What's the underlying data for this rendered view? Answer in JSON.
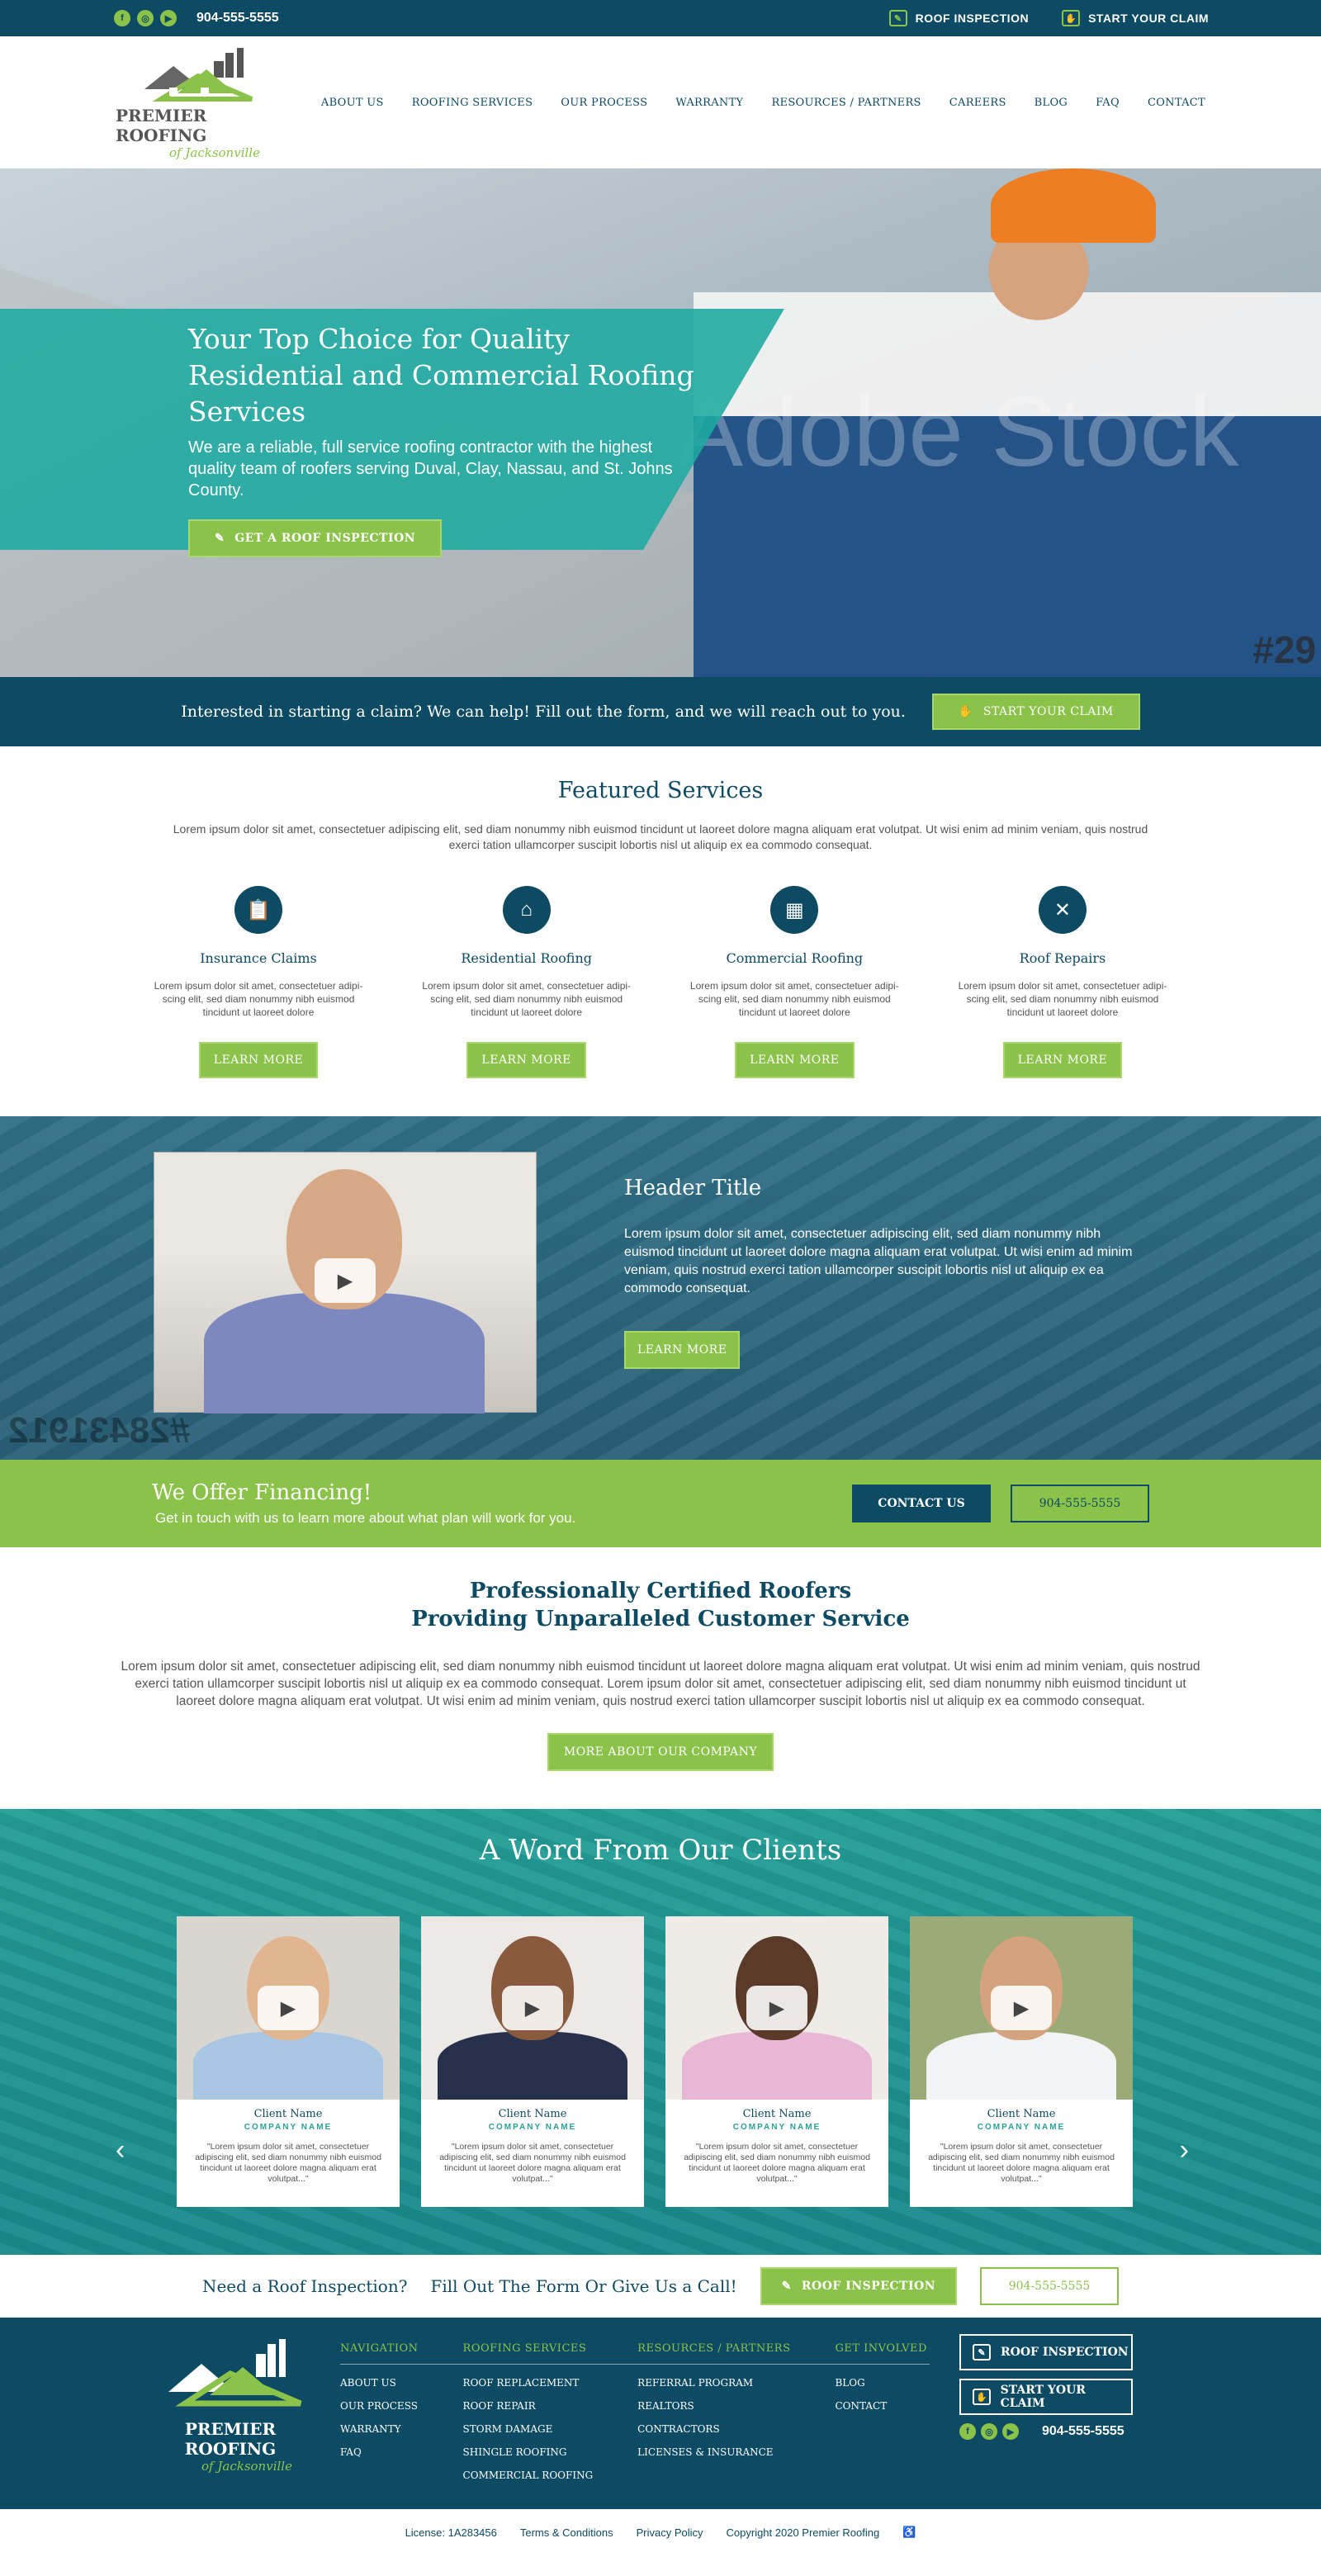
{
  "topbar": {
    "phone": "904-555-5555",
    "social": [
      "facebook-icon",
      "instagram-icon",
      "youtube-icon"
    ],
    "links": [
      {
        "label": "ROOF INSPECTION",
        "icon": "clipboard-icon"
      },
      {
        "label": "START YOUR CLAIM",
        "icon": "claim-icon"
      }
    ]
  },
  "logo": {
    "name": "PREMIER ROOFING",
    "tagline": "of Jacksonville"
  },
  "nav": [
    "ABOUT US",
    "ROOFING SERVICES",
    "OUR PROCESS",
    "WARRANTY",
    "RESOURCES / PARTNERS",
    "CAREERS",
    "BLOG",
    "FAQ",
    "CONTACT"
  ],
  "hero": {
    "title": "Your Top Choice for Quality Residential and Commercial Roofing Services",
    "subtitle": "We are a reliable, full service roofing contractor with the highest quality team of roofers serving Duval, Clay, Nassau, and St. Johns County.",
    "button": "GET A ROOF INSPECTION",
    "watermark": "Adobe Stock",
    "watermark_id": "#29"
  },
  "claim_bar": {
    "text": "Interested in starting a claim?   We can help!   Fill out the form, and we will reach out to you.",
    "button": "START YOUR CLAIM"
  },
  "featured": {
    "title": "Featured Services",
    "intro": "Lorem ipsum dolor sit amet, consectetuer adipiscing elit, sed diam nonummy nibh euismod tincidunt ut laoreet dolore magna aliquam erat volutpat. Ut wisi enim ad minim veniam, quis nostrud exerci tation ullamcorper suscipit lobortis nisl ut aliquip ex ea commodo consequat.",
    "services": [
      {
        "title": "Insurance Claims",
        "icon": "clipboard-icon",
        "text": "Lorem ipsum dolor sit amet, consectetuer adipi-scing elit, sed diam nonummy nibh euismod tincidunt ut laoreet dolore",
        "button": "LEARN MORE"
      },
      {
        "title": "Residential Roofing",
        "icon": "house-icon",
        "text": "Lorem ipsum dolor sit amet, consectetuer adipi-scing elit, sed diam nonummy nibh euismod tincidunt ut laoreet dolore",
        "button": "LEARN MORE"
      },
      {
        "title": "Commercial Roofing",
        "icon": "building-icon",
        "text": "Lorem ipsum dolor sit amet, consectetuer adipi-scing elit, sed diam nonummy nibh euismod tincidunt ut laoreet dolore",
        "button": "LEARN MORE"
      },
      {
        "title": "Roof Repairs",
        "icon": "tools-icon",
        "text": "Lorem ipsum dolor sit amet, consectetuer adipi-scing elit, sed diam nonummy nibh euismod tincidunt ut laoreet dolore",
        "button": "LEARN MORE"
      }
    ]
  },
  "video": {
    "title": "Header Title",
    "text": "Lorem ipsum dolor sit amet, consectetuer adipiscing elit, sed diam nonummy nibh euismod tincidunt ut laoreet dolore magna aliquam erat volutpat. Ut wisi enim ad minim veniam, quis nostrud exerci tation ullamcorper suscipit lobortis nisl ut aliquip ex ea commodo consequat.",
    "button": "LEARN MORE",
    "watermark_id": "#28431912"
  },
  "financing": {
    "title": "We Offer Financing!",
    "text": "Get in touch with us to learn more about what plan will work for you.",
    "contact_button": "CONTACT US",
    "phone_button": "904-555-5555"
  },
  "certified": {
    "title_line1": "Professionally Certified Roofers",
    "title_line2": "Providing Unparalleled Customer Service",
    "text": "Lorem ipsum dolor sit amet, consectetuer adipiscing elit, sed diam nonummy nibh euismod tincidunt ut laoreet dolore magna aliquam erat volutpat. Ut wisi enim ad minim veniam, quis nostrud exerci tation ullamcorper suscipit lobortis nisl ut aliquip ex ea commodo consequat. Lorem ipsum dolor sit amet, consectetuer adipiscing elit, sed diam nonummy nibh euismod tincidunt ut laoreet dolore magna aliquam erat volutpat. Ut wisi enim ad minim veniam, quis nostrud exerci tation ullamcorper suscipit lobortis nisl ut aliquip ex ea commodo consequat.",
    "button": "MORE ABOUT OUR COMPANY"
  },
  "testimonials": {
    "title": "A Word From Our Clients",
    "cards": [
      {
        "name": "Client Name",
        "company": "COMPANY NAME",
        "quote": "\"Lorem ipsum dolor sit amet, consectetuer adipiscing elit, sed diam nonummy nibh euismod tincidunt ut laoreet dolore magna aliquam erat volutpat...\"",
        "skin": "#e2b591",
        "shirt": "#a9c6e3",
        "bg": "#d9d6d0"
      },
      {
        "name": "Client Name",
        "company": "COMPANY NAME",
        "quote": "\"Lorem ipsum dolor sit amet, consectetuer adipiscing elit, sed diam nonummy nibh euismod tincidunt ut laoreet dolore magna aliquam erat volutpat...\"",
        "skin": "#8a5a3f",
        "shirt": "#27304a",
        "bg": "#ece9e6"
      },
      {
        "name": "Client Name",
        "company": "COMPANY NAME",
        "quote": "\"Lorem ipsum dolor sit amet, consectetuer adipiscing elit, sed diam nonummy nibh euismod tincidunt ut laoreet dolore magna aliquam erat volutpat...\"",
        "skin": "#5b3a2a",
        "shirt": "#e8b7d5",
        "bg": "#efece8"
      },
      {
        "name": "Client Name",
        "company": "COMPANY NAME",
        "quote": "\"Lorem ipsum dolor sit amet, consectetuer adipiscing elit, sed diam nonummy nibh euismod tincidunt ut laoreet dolore magna aliquam erat volutpat...\"",
        "skin": "#d4a27e",
        "shirt": "#f1f3f5",
        "bg": "#9bab78"
      }
    ]
  },
  "cta_bar": {
    "text1": "Need a Roof Inspection?",
    "text2": "Fill Out The Form Or Give Us a Call!",
    "button": "ROOF INSPECTION",
    "phone_button": "904-555-5555"
  },
  "footer": {
    "columns": [
      {
        "title": "NAVIGATION",
        "items": [
          "ABOUT US",
          "OUR PROCESS",
          "WARRANTY",
          "FAQ"
        ]
      },
      {
        "title": "ROOFING SERVICES",
        "items": [
          "ROOF REPLACEMENT",
          "ROOF REPAIR",
          "STORM DAMAGE",
          "SHINGLE ROOFING",
          "COMMERCIAL ROOFING"
        ]
      },
      {
        "title": "RESOURCES / PARTNERS",
        "items": [
          "REFERRAL PROGRAM",
          "REALTORS",
          "CONTRACTORS",
          "LICENSES & INSURANCE"
        ]
      },
      {
        "title": "GET INVOLVED",
        "items": [
          "BLOG",
          "CONTACT"
        ]
      }
    ],
    "buttons": [
      "ROOF INSPECTION",
      "START YOUR CLAIM"
    ],
    "phone": "904-555-5555"
  },
  "legal": {
    "license": "License: 1A283456",
    "terms": "Terms & Conditions",
    "privacy": "Privacy Policy",
    "copyright": "Copyright 2020 Premier Roofing"
  },
  "colors": {
    "navy": "#0d4a63",
    "green": "#8bc34a",
    "teal": "#1caaa0"
  }
}
